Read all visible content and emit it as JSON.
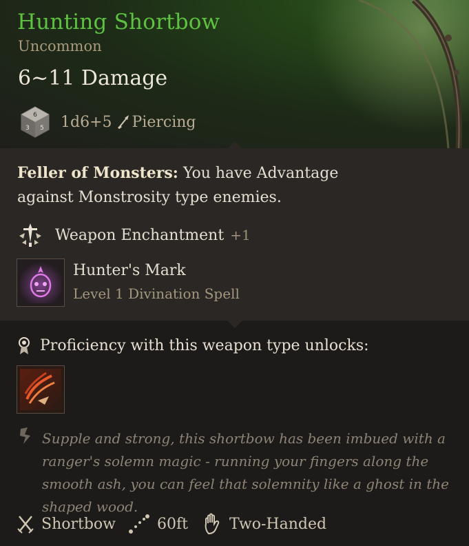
{
  "item": {
    "name": "Hunting Shortbow",
    "rarity": "Uncommon",
    "damage": "6~11 Damage",
    "dice": "1d6+5",
    "damage_type": "Piercing",
    "name_color": "#5fc141"
  },
  "passive": {
    "name": "Feller of Monsters:",
    "description": "You have Advantage against Monstrosity type enemies."
  },
  "enchantment": {
    "label": "Weapon Enchantment",
    "bonus": "+1",
    "icon": "sword-enchant-icon"
  },
  "spell": {
    "name": "Hunter's Mark",
    "level": "Level 1 Divination Spell",
    "icon": "hunters-mark-icon"
  },
  "proficiency": {
    "text": "Proficiency with this weapon type unlocks:",
    "action_icon": "weapon-action-icon"
  },
  "flavor": "Supple and strong, this shortbow has been imbued with a ranger's solemn magic - running your fingers along the smooth ash, you can feel that solemnity like a ghost in the shaped wood.",
  "footer": {
    "weapon_type": "Shortbow",
    "range": "60ft",
    "handedness": "Two-Handed"
  }
}
